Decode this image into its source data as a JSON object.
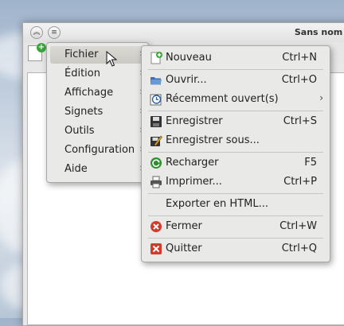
{
  "window": {
    "title": "Sans nom - K"
  },
  "menubar_menu": {
    "items": [
      {
        "label": "Fichier"
      },
      {
        "label": "Édition"
      },
      {
        "label": "Affichage"
      },
      {
        "label": "Signets"
      },
      {
        "label": "Outils"
      },
      {
        "label": "Configuration"
      },
      {
        "label": "Aide"
      }
    ]
  },
  "file_menu": {
    "items": [
      {
        "label": "Nouveau",
        "shortcut": "Ctrl+N"
      },
      {
        "label": "Ouvrir...",
        "shortcut": "Ctrl+O"
      },
      {
        "label": "Récemment ouvert(s)"
      },
      {
        "label": "Enregistrer",
        "shortcut": "Ctrl+S"
      },
      {
        "label": "Enregistrer sous..."
      },
      {
        "label": "Recharger",
        "shortcut": "F5"
      },
      {
        "label": "Imprimer...",
        "shortcut": "Ctrl+P"
      },
      {
        "label": "Exporter en HTML..."
      },
      {
        "label": "Fermer",
        "shortcut": "Ctrl+W"
      },
      {
        "label": "Quitter",
        "shortcut": "Ctrl+Q"
      }
    ]
  },
  "icons": {
    "new": "new-document-icon",
    "open": "folder-open-icon",
    "recent": "clock-icon",
    "save": "floppy-disk-icon",
    "save_as": "save-as-icon",
    "reload": "reload-icon",
    "print": "printer-icon",
    "close": "close-icon",
    "quit": "quit-icon"
  }
}
